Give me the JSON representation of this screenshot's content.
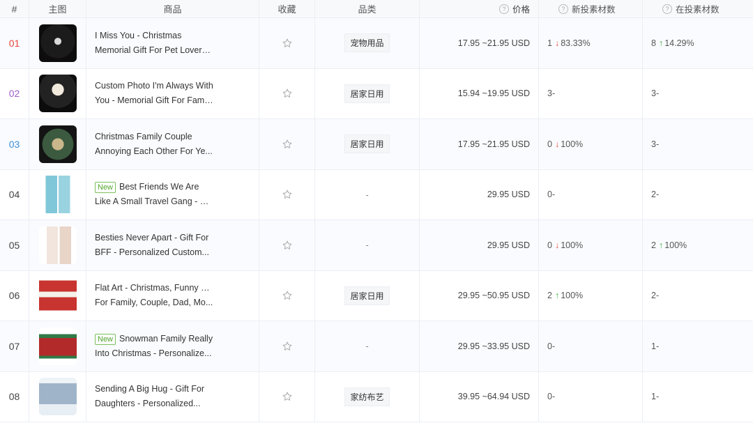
{
  "headers": {
    "index": "#",
    "image": "主图",
    "product": "商品",
    "favorite": "收藏",
    "category": "品类",
    "price": "价格",
    "new_ads": "新投素材数",
    "active_ads": "在投素材数"
  },
  "rows": [
    {
      "idx": "01",
      "idx_color": "#e8453c",
      "badge": "",
      "line1": "I Miss You - Christmas",
      "line2": "Memorial Gift For Pet Lovers,...",
      "category": "宠物用品",
      "price": "17.95 ~21.95 USD",
      "new_count": "1",
      "new_dir": "down",
      "new_pct": "83.33%",
      "on_count": "8",
      "on_dir": "up",
      "on_pct": "14.29%",
      "thumb": "ornament-dark"
    },
    {
      "idx": "02",
      "idx_color": "#a05fc9",
      "badge": "",
      "line1": "Custom Photo I'm Always With",
      "line2": "You - Memorial Gift For Famil...",
      "category": "居家日用",
      "price": "15.94 ~19.95 USD",
      "new_count": "3",
      "new_dir": "",
      "new_pct": "-",
      "on_count": "3",
      "on_dir": "",
      "on_pct": "-",
      "thumb": "ornament-photo"
    },
    {
      "idx": "03",
      "idx_color": "#3a8fd6",
      "badge": "",
      "line1": "Christmas Family Couple",
      "line2": "Annoying Each Other For Ye...",
      "category": "居家日用",
      "price": "17.95 ~21.95 USD",
      "new_count": "0",
      "new_dir": "down",
      "new_pct": "100%",
      "on_count": "3",
      "on_dir": "",
      "on_pct": "-",
      "thumb": "ornament-couple"
    },
    {
      "idx": "04",
      "idx_color": "#444",
      "badge": "New",
      "line1": "Best Friends We Are",
      "line2": "Like A Small Travel Gang - Gi...",
      "category": "-",
      "price": "29.95 USD",
      "new_count": "0",
      "new_dir": "",
      "new_pct": "-",
      "on_count": "2",
      "on_dir": "",
      "on_pct": "-",
      "thumb": "tumbler-blue"
    },
    {
      "idx": "05",
      "idx_color": "#444",
      "badge": "",
      "line1": "Besties Never Apart - Gift For",
      "line2": "BFF - Personalized Custom...",
      "category": "-",
      "price": "29.95 USD",
      "new_count": "0",
      "new_dir": "down",
      "new_pct": "100%",
      "on_count": "2",
      "on_dir": "up",
      "on_pct": "100%",
      "thumb": "tumbler-red"
    },
    {
      "idx": "06",
      "idx_color": "#444",
      "badge": "",
      "line1": "Flat Art - Christmas, Funny Gift",
      "line2": "For Family, Couple, Dad, Mo...",
      "category": "居家日用",
      "price": "29.95 ~50.95 USD",
      "new_count": "2",
      "new_dir": "up",
      "new_pct": "100%",
      "on_count": "2",
      "on_dir": "",
      "on_pct": "-",
      "thumb": "sweater"
    },
    {
      "idx": "07",
      "idx_color": "#444",
      "badge": "New",
      "line1": "Snowman Family Really",
      "line2": "Into Christmas - Personalize...",
      "category": "-",
      "price": "29.95 ~33.95 USD",
      "new_count": "0",
      "new_dir": "",
      "new_pct": "-",
      "on_count": "1",
      "on_dir": "",
      "on_pct": "-",
      "thumb": "doormat"
    },
    {
      "idx": "08",
      "idx_color": "#444",
      "badge": "",
      "line1": "Sending A Big Hug - Gift For",
      "line2": "Daughters - Personalized...",
      "category": "家纺布艺",
      "price": "39.95 ~64.94 USD",
      "new_count": "0",
      "new_dir": "",
      "new_pct": "-",
      "on_count": "1",
      "on_dir": "",
      "on_pct": "-",
      "thumb": "blanket"
    }
  ],
  "icons": {
    "help": "question-circle-icon",
    "favorite": "star-outline-icon",
    "down": "arrow-down-icon",
    "up": "arrow-up-icon"
  }
}
